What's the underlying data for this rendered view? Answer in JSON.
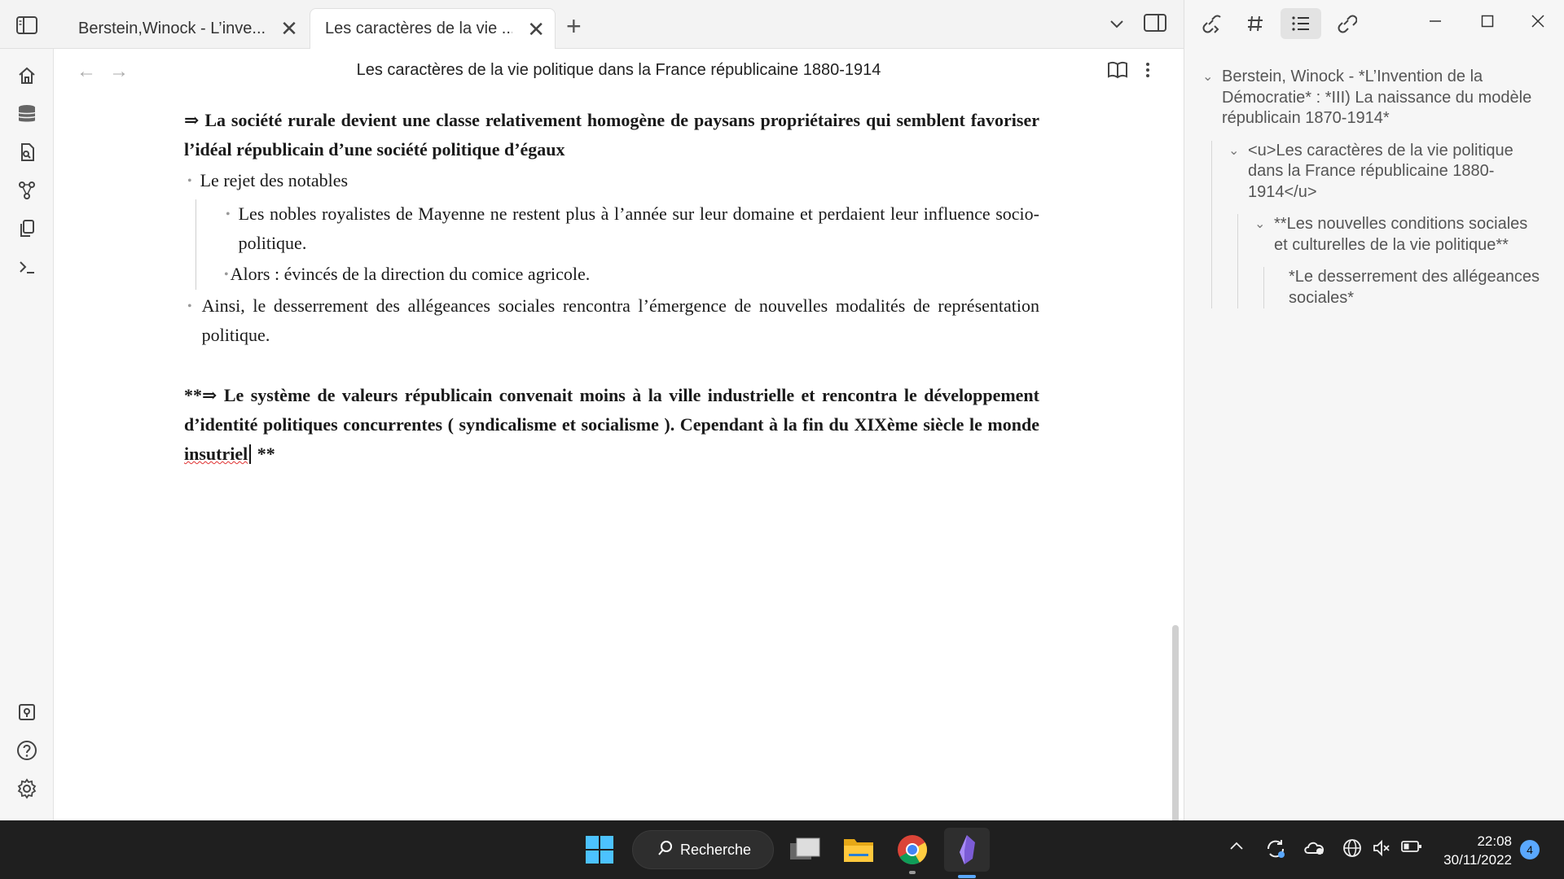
{
  "tabs": [
    {
      "title": "Berstein,Winock - L’inve...",
      "close": "✕"
    },
    {
      "title": "Les caractères de la vie ...",
      "close": "✕"
    }
  ],
  "new_tab": "+",
  "view": {
    "title": "Les caractères de la vie politique dans la France républicaine 1880-1914",
    "back": "←",
    "forward": "→"
  },
  "doc": {
    "p1": "⇒ La société rurale devient une classe relativement homogène de paysans propriétaires qui semblent favoriser l’idéal républicain d’une société politique d’égaux",
    "b1": "Le rejet des notables",
    "b1a": "Les nobles royalistes de Mayenne ne restent plus à l’année sur leur domaine et perdaient leur influence socio-politique.",
    "b1b": "Alors : évincés de la direction du comice agricole.",
    "b2": "Ainsi, le desserrement des allégeances sociales rencontra l’émergence de nouvelles modalités de représentation politique.",
    "p2_prefix": "**⇒ Le système de valeurs républicain convenait moins à la ville industrielle et rencontra le développement d’identité politiques concurrentes ( syndicalisme et socialisme ). Cependant à la fin du XIXème siècle le monde ",
    "p2_misspelled": "insutriel",
    "p2_suffix": " **"
  },
  "outline": {
    "h1": "Berstein, Winock - *L’Invention de la Démocratie* : *III) La naissance du modèle républicain 1870-1914*",
    "h2": "<u>Les caractères de la vie politique dans la France républicaine 1880-1914</u>",
    "h3": "**Les nouvelles conditions sociales et culturelles de la vie politique**",
    "h4": "*Le desserrement des allégeances sociales*"
  },
  "taskbar": {
    "search_label": "Recherche",
    "time": "22:08",
    "date": "30/11/2022",
    "notification_count": "4"
  },
  "icons": [
    "sidebar-toggle-icon",
    "home-icon",
    "database-icon",
    "file-search-icon",
    "graph-icon",
    "copy-icon",
    "terminal-icon",
    "vault-icon",
    "help-icon",
    "settings-icon",
    "backlinks-icon",
    "tag-icon",
    "outline-icon",
    "outgoing-links-icon",
    "book-open-icon",
    "more-vertical-icon",
    "chevron-down-icon"
  ],
  "colors": {
    "accent": "#5aa8ff",
    "spellcheck": "#e03030"
  }
}
